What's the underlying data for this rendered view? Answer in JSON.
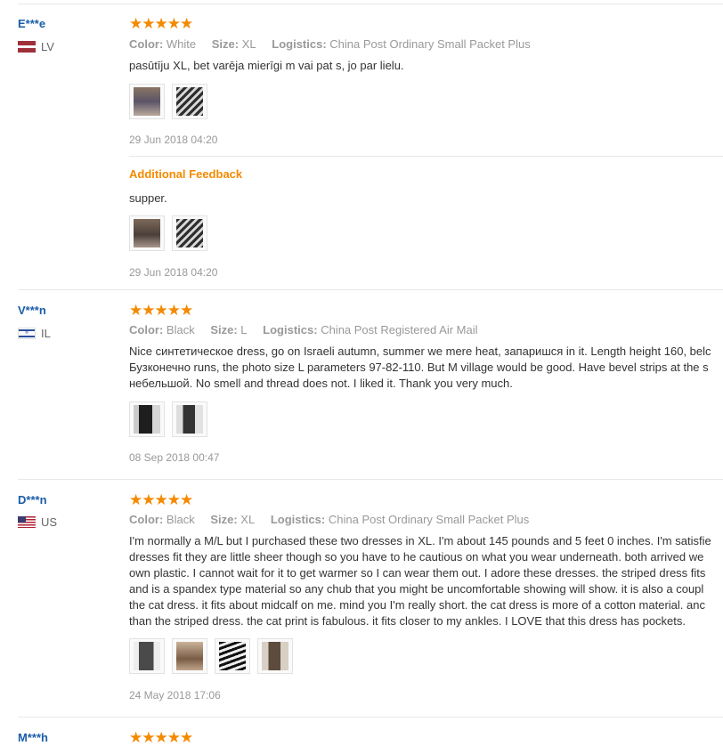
{
  "reviews": [
    {
      "user": "E***e",
      "country": "LV",
      "stars": "★★★★★",
      "color_label": "Color:",
      "color": "White",
      "size_label": "Size:",
      "size": "XL",
      "logistics_label": "Logistics:",
      "logistics": "China Post Ordinary Small Packet Plus",
      "text": [
        "pasūtīju XL, bet varēja mierīgi m vai pat s, jo par lielu."
      ],
      "photos": [
        "photo",
        "photo"
      ],
      "date": "29 Jun 2018 04:20",
      "additional": {
        "label": "Additional Feedback",
        "text": "supper.",
        "photos": [
          "photo",
          "photo"
        ],
        "date": "29 Jun 2018 04:20"
      }
    },
    {
      "user": "V***n",
      "country": "IL",
      "stars": "★★★★★",
      "color_label": "Color:",
      "color": "Black",
      "size_label": "Size:",
      "size": "L",
      "logistics_label": "Logistics:",
      "logistics": "China Post Registered Air Mail",
      "text": [
        "Nice синтетическое dress, go on Israeli autumn, summer we mere heat, запаришся in it. Length height 160, belc",
        "Бузконечно runs, the photo size L parameters 97-82-110. But M village would be good. Have bevel strips at the s",
        "небельшой. No smell and thread does not. I liked it. Thank you very much."
      ],
      "photos": [
        "photo",
        "photo"
      ],
      "date": "08 Sep 2018 00:47"
    },
    {
      "user": "D***n",
      "country": "US",
      "stars": "★★★★★",
      "color_label": "Color:",
      "color": "Black",
      "size_label": "Size:",
      "size": "XL",
      "logistics_label": "Logistics:",
      "logistics": "China Post Ordinary Small Packet Plus",
      "text": [
        "I'm normally a M/L but I purchased these two dresses in XL. I'm about 145 pounds and 5 feet 0 inches. I'm satisfie",
        "dresses fit they are little sheer though so you have to he cautious on what you wear underneath. both arrived we",
        "own plastic. I cannot wait for it to get warmer so I can wear them out. I adore these dresses. the striped dress fits",
        "and is a spandex type material so any chub that you might be uncomfortable showing will show. it is also a coupl",
        "the cat dress. it fits about midcalf on me. mind you I'm really short. the cat dress is more of a cotton material. anc",
        "than the striped dress. the cat print is fabulous. it fits closer to my ankles. I LOVE that this dress has pockets."
      ],
      "photos": [
        "photo",
        "photo",
        "photo",
        "photo"
      ],
      "date": "24 May 2018 17:06"
    },
    {
      "user": "M***h",
      "stars": "★★★★★"
    }
  ],
  "colors": {
    "accent": "#f48a00",
    "user": "#1a5ea8",
    "muted": "#999999"
  }
}
